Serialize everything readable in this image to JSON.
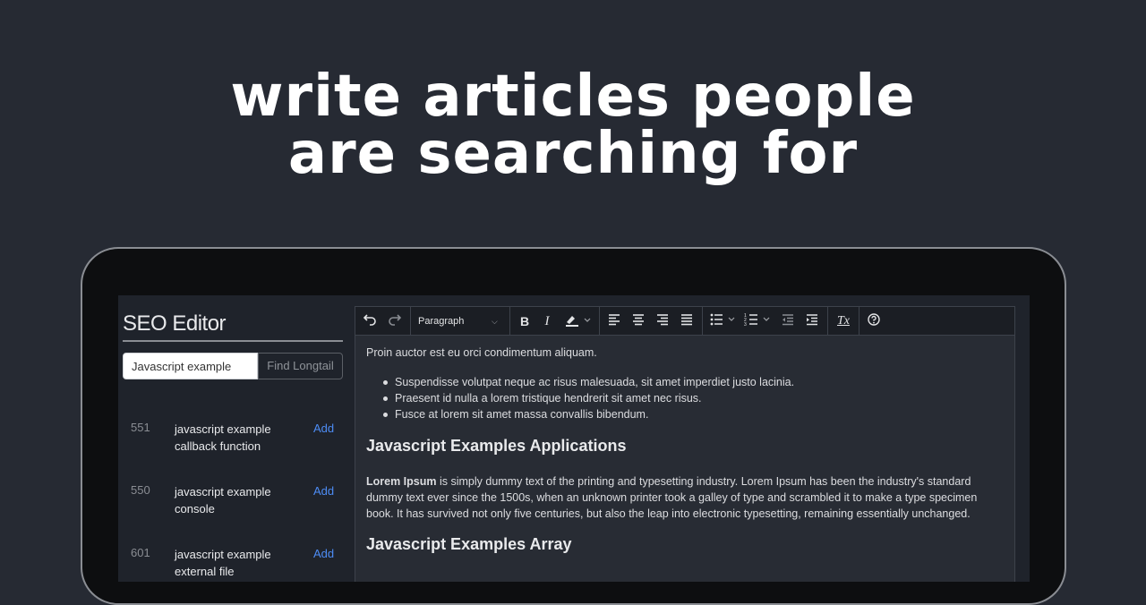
{
  "headline": {
    "line1": "write articles people",
    "line2": "are searching for"
  },
  "sidebar": {
    "title": "SEO Editor",
    "search_value": "Javascript example",
    "find_button": "Find Longtail",
    "keywords": [
      {
        "count": "551",
        "text": "javascript example callback function",
        "add": "Add"
      },
      {
        "count": "550",
        "text": "javascript example console",
        "add": "Add"
      },
      {
        "count": "601",
        "text": "javascript example external file",
        "add": "Add"
      }
    ]
  },
  "toolbar": {
    "block_format": "Paragraph",
    "bold": "B",
    "italic": "I",
    "clear_format": "Tx",
    "icons": [
      "undo-icon",
      "redo-icon",
      "bold-icon",
      "italic-icon",
      "highlight-icon",
      "align-left-icon",
      "align-center-icon",
      "align-right-icon",
      "align-justify-icon",
      "bullet-list-icon",
      "numbered-list-icon",
      "outdent-icon",
      "indent-icon",
      "clear-format-icon",
      "help-icon"
    ]
  },
  "content": {
    "intro": "Proin auctor est eu orci condimentum aliquam.",
    "bullets": [
      "Suspendisse volutpat neque ac risus malesuada, sit amet imperdiet justo lacinia.",
      "Praesent id nulla a lorem tristique hendrerit sit amet nec risus.",
      "Fusce at lorem sit amet massa convallis bibendum."
    ],
    "heading1": "Javascript Examples Applications",
    "para_bold": "Lorem Ipsum",
    "para_rest": " is simply dummy text of the printing and typesetting industry. Lorem Ipsum has been the industry's standard dummy text ever since the 1500s, when an unknown printer took a galley of type and scrambled it to make a type specimen book. It has survived not only five centuries, but also the leap into electronic typesetting, remaining essentially unchanged.",
    "heading2": "Javascript Examples Array"
  },
  "colors": {
    "background": "#262a33",
    "laptop_bezel": "#0d0e10",
    "screen": "#1f232b",
    "accent_link": "#4d8cf5"
  }
}
